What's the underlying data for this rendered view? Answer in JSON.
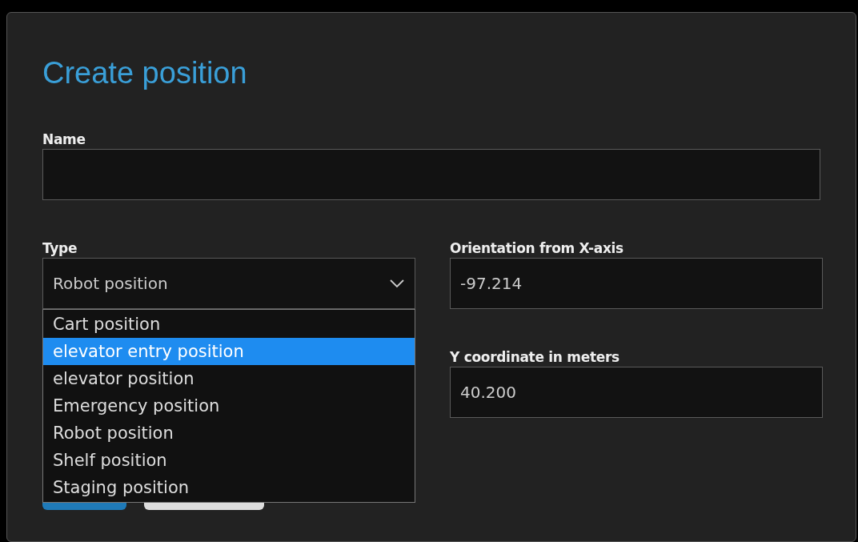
{
  "dialog": {
    "title": "Create position"
  },
  "name_field": {
    "label": "Name"
  },
  "type_field": {
    "label": "Type",
    "value": "Robot position",
    "expanded": true,
    "options": [
      {
        "label": "Cart position",
        "highlighted": false
      },
      {
        "label": "elevator entry position",
        "highlighted": true
      },
      {
        "label": "elevator position",
        "highlighted": false
      },
      {
        "label": "Emergency position",
        "highlighted": false
      },
      {
        "label": "Robot position",
        "highlighted": false
      },
      {
        "label": "Shelf position",
        "highlighted": false
      },
      {
        "label": "Staging position",
        "highlighted": false
      }
    ]
  },
  "orientation_field": {
    "label": "Orientation from X-axis",
    "value": "-97.214"
  },
  "y_field": {
    "label": "Y coordinate in meters",
    "value": "40.200"
  },
  "buttons": [
    {
      "kind": "primary"
    },
    {
      "kind": "secondary"
    }
  ]
}
